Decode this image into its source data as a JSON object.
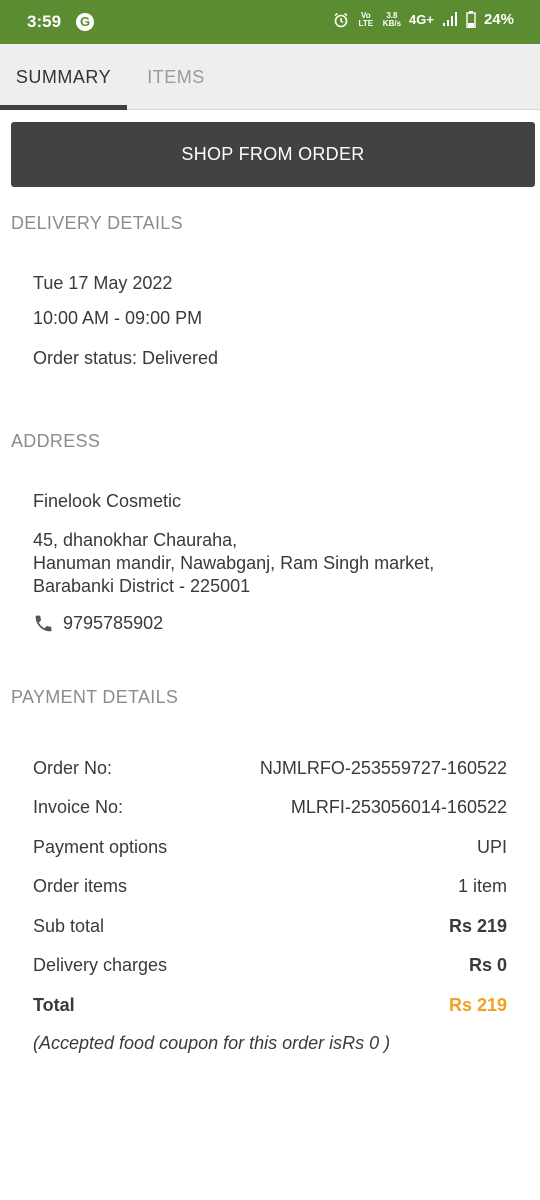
{
  "status_bar": {
    "time": "3:59",
    "g_glyph": "G",
    "volte_label": "Vo LTE",
    "speed_value": "3.8",
    "speed_unit": "KB/s",
    "network": "4G+",
    "battery": "24%",
    "bg_color": "#5b8c31"
  },
  "tabs": [
    {
      "label": "SUMMARY",
      "active": true
    },
    {
      "label": "ITEMS",
      "active": false
    }
  ],
  "shop_button": {
    "label": "SHOP FROM ORDER"
  },
  "delivery": {
    "title": "DELIVERY DETAILS",
    "date": "Tue 17 May 2022",
    "time_window": "10:00 AM - 09:00 PM",
    "status": "Order status: Delivered"
  },
  "address": {
    "title": "ADDRESS",
    "name": "Finelook Cosmetic",
    "line1": "45, dhanokhar Chauraha,",
    "line2": "Hanuman mandir, Nawabganj, Ram Singh market,",
    "line3": "Barabanki District - 225001",
    "phone": "9795785902",
    "phone_icon": "phone-icon"
  },
  "payment": {
    "title": "PAYMENT DETAILS",
    "rows": [
      {
        "label": "Order No:",
        "value": "NJMLRFO-253559727-160522"
      },
      {
        "label": "Invoice No:",
        "value": "MLRFI-253056014-160522"
      },
      {
        "label": "Payment options",
        "value": "UPI"
      },
      {
        "label": "Order items",
        "value": "1 item"
      },
      {
        "label": "Sub total",
        "value": "Rs 219"
      },
      {
        "label": "Delivery charges",
        "value": "Rs 0"
      },
      {
        "label": "Total",
        "value": "Rs 219"
      }
    ],
    "coupon_note": "(Accepted food coupon for this order isRs 0 )",
    "total_color": "#f2a023"
  }
}
